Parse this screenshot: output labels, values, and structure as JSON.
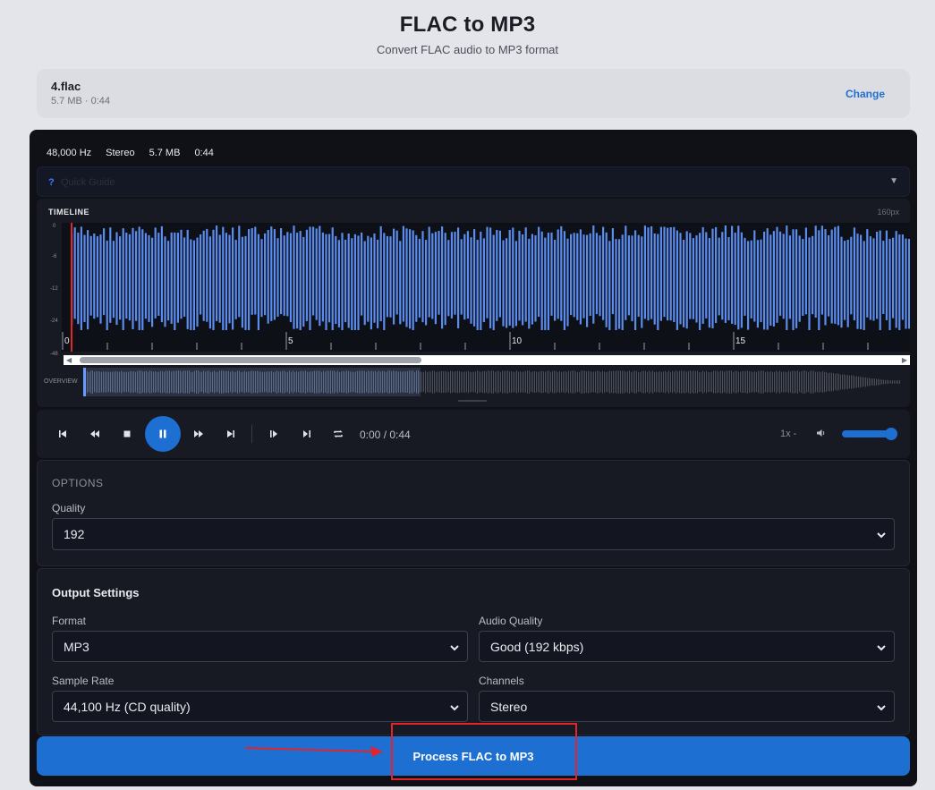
{
  "header": {
    "title": "FLAC to MP3",
    "subtitle": "Convert FLAC audio to MP3 format"
  },
  "file": {
    "name": "4.flac",
    "meta": "5.7 MB · 0:44",
    "change_label": "Change"
  },
  "stats": {
    "sample_rate": "48,000 Hz",
    "channels": "Stereo",
    "size": "5.7 MB",
    "duration": "0:44"
  },
  "guide": {
    "icon": "?",
    "label": "Quick Guide"
  },
  "timeline": {
    "label": "TIMELINE",
    "zoom": "160px",
    "db_ticks": [
      "0",
      "-6",
      "-12",
      "-24",
      "-48"
    ],
    "ruler_labels": [
      "0",
      "5",
      "10",
      "15"
    ],
    "overview_label": "OVERVIEW",
    "scroll_position": 0.4
  },
  "player": {
    "current_time": "0:00",
    "total_time": "0:44",
    "time_display": "0:00 / 0:44",
    "speed": "1x -",
    "state": "playing",
    "volume": 1.0
  },
  "options": {
    "title": "OPTIONS",
    "quality_label": "Quality",
    "quality_value": "192"
  },
  "output_settings": {
    "title": "Output Settings",
    "format_label": "Format",
    "format_value": "MP3",
    "audio_quality_label": "Audio Quality",
    "audio_quality_value": "Good (192 kbps)",
    "sample_rate_label": "Sample Rate",
    "sample_rate_value": "44,100 Hz (CD quality)",
    "channels_label": "Channels",
    "channels_value": "Stereo"
  },
  "process_button": "Process FLAC to MP3",
  "colors": {
    "accent": "#1d6fd1",
    "waveform": "#5b8dee",
    "annotation": "#e3242b"
  }
}
